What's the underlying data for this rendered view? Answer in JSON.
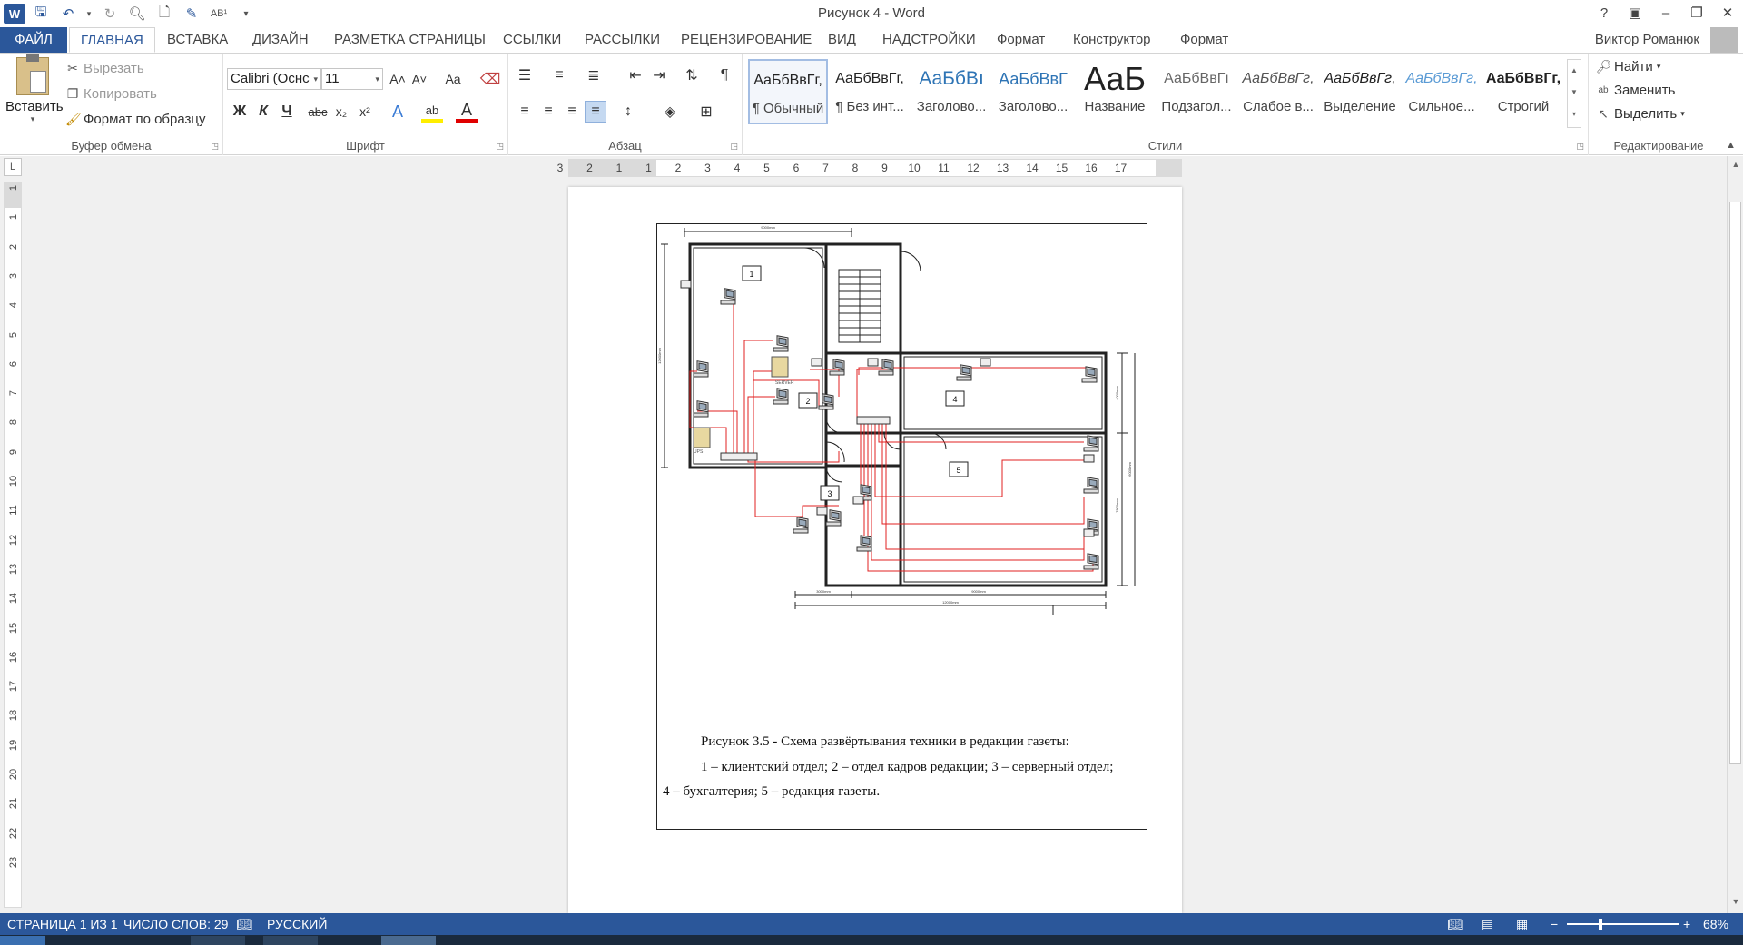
{
  "window": {
    "title": "Рисунок 4 - Word"
  },
  "qat": {
    "icons": [
      "word-logo",
      "save-icon",
      "undo-icon",
      "redo-icon",
      "print-preview-icon",
      "new-doc-icon",
      "save-as-icon",
      "spelling-icon",
      "customize-icon"
    ],
    "word_letter": "W",
    "spell_label": "AB¹"
  },
  "tabs": [
    {
      "label": "ФАЙЛ"
    },
    {
      "label": "ГЛАВНАЯ"
    },
    {
      "label": "ВСТАВКА"
    },
    {
      "label": "ДИЗАЙН"
    },
    {
      "label": "РАЗМЕТКА СТРАНИЦЫ"
    },
    {
      "label": "ССЫЛКИ"
    },
    {
      "label": "РАССЫЛКИ"
    },
    {
      "label": "РЕЦЕНЗИРОВАНИЕ"
    },
    {
      "label": "ВИД"
    },
    {
      "label": "НАДСТРОЙКИ"
    },
    {
      "label": "Формат"
    },
    {
      "label": "Конструктор"
    },
    {
      "label": "Формат"
    }
  ],
  "user": {
    "name": "Виктор Романюк"
  },
  "ribbon": {
    "clipboard": {
      "label": "Буфер обмена",
      "paste": "Вставить",
      "cut": "Вырезать",
      "copy": "Копировать",
      "format_painter": "Формат по образцу"
    },
    "font": {
      "label": "Шрифт",
      "name": "Calibri (Оснс",
      "size": "11",
      "bold": "Ж",
      "italic": "К",
      "underline": "Ч",
      "strike": "abc",
      "sub": "x₂",
      "sup": "x²",
      "grow": "A˄",
      "shrink": "A˅",
      "case": "Aa",
      "effects": "A",
      "highlight": "ab",
      "color": "A"
    },
    "paragraph": {
      "label": "Абзац"
    },
    "styles": {
      "label": "Стили",
      "items": [
        {
          "sample": "АаБбВвГг,",
          "name": "¶ Обычный"
        },
        {
          "sample": "АаБбВвГг,",
          "name": "¶ Без инт..."
        },
        {
          "sample": "АаБбВı",
          "name": "Заголово..."
        },
        {
          "sample": "АаБбВвГ",
          "name": "Заголово..."
        },
        {
          "sample": "АаБ",
          "name": "Название"
        },
        {
          "sample": "АаБбВвГı",
          "name": "Подзагол..."
        },
        {
          "sample": "АаБбВвГг,",
          "name": "Слабое в..."
        },
        {
          "sample": "АаБбВвГг,",
          "name": "Выделение"
        },
        {
          "sample": "АаБбВвГг,",
          "name": "Сильное..."
        },
        {
          "sample": "АаБбВвГг,",
          "name": "Строгий"
        }
      ]
    },
    "editing": {
      "label": "Редактирование",
      "find": "Найти",
      "replace": "Заменить",
      "select": "Выделить"
    }
  },
  "ruler": {
    "h_labels": [
      "3",
      "2",
      "1",
      "1",
      "2",
      "3",
      "4",
      "5",
      "6",
      "7",
      "8",
      "9",
      "10",
      "11",
      "12",
      "13",
      "14",
      "15",
      "16",
      "17"
    ],
    "v_labels": [
      "1",
      "1",
      "2",
      "3",
      "4",
      "5",
      "6",
      "7",
      "8",
      "9",
      "10",
      "11",
      "12",
      "13",
      "14",
      "15",
      "16",
      "17",
      "18",
      "19",
      "20",
      "21",
      "22",
      "23"
    ],
    "corner": "L"
  },
  "document": {
    "figure": {
      "room_labels": [
        "1",
        "2",
        "3",
        "4",
        "5"
      ],
      "dimensions": [
        "9000mm",
        "12000mm",
        "4000mm",
        "6000mm",
        "7800mm",
        "3000mm",
        "9000mm",
        "12000mm"
      ],
      "server_label": "SERVER",
      "ups_label": "UPS"
    },
    "caption_line1": "Рисунок 3.5 - Схема развёртывания техники в редакции газеты:",
    "caption_line2": "1 – клиентский отдел; 2 – отдел кадров редакции; 3 – серверный отдел;",
    "caption_line3": "4 – бухгалтерия; 5 – редакция газеты."
  },
  "statusbar": {
    "page": "СТРАНИЦА 1 ИЗ 1",
    "words": "ЧИСЛО СЛОВ: 29",
    "language": "РУССКИЙ",
    "zoom": "68%",
    "zoom_minus": "−",
    "zoom_plus": "+"
  },
  "colors": {
    "accent": "#2b579a",
    "network_cable": "#e02020"
  }
}
